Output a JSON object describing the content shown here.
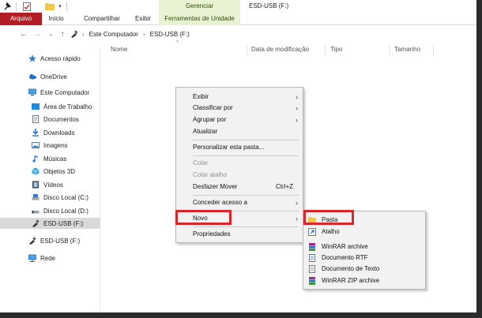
{
  "titlebar": {
    "window_title": "ESD-USB (F:)",
    "context_tab_group": "Gerenciar"
  },
  "ribbon_tabs": [
    {
      "label": "Arquivo"
    },
    {
      "label": "Início"
    },
    {
      "label": "Compartilhar"
    },
    {
      "label": "Exibir"
    },
    {
      "label": "Ferramentas de Unidade"
    }
  ],
  "address": {
    "path": [
      "Este Computador",
      "ESD-USB (F:)"
    ]
  },
  "sidebar": {
    "items": [
      {
        "label": "Acesso rápido",
        "icon": "star-icon"
      },
      {
        "label": "OneDrive",
        "icon": "cloud-icon"
      },
      {
        "label": "Este Computador",
        "icon": "computer-icon"
      },
      {
        "label": "Área de Trabalho",
        "icon": "desktop-icon"
      },
      {
        "label": "Documentos",
        "icon": "documents-icon"
      },
      {
        "label": "Downloads",
        "icon": "download-icon"
      },
      {
        "label": "Imagens",
        "icon": "pictures-icon"
      },
      {
        "label": "Músicas",
        "icon": "music-icon"
      },
      {
        "label": "Objetos 3D",
        "icon": "cube-icon"
      },
      {
        "label": "Vídeos",
        "icon": "video-icon"
      },
      {
        "label": "Disco Local (C:)",
        "icon": "drive-icon"
      },
      {
        "label": "Disco Local (D:)",
        "icon": "drive-icon"
      },
      {
        "label": "ESD-USB (F:)",
        "icon": "usb-icon"
      },
      {
        "label": "ESD-USB (F:)",
        "icon": "usb-icon"
      },
      {
        "label": "Rede",
        "icon": "network-icon"
      }
    ]
  },
  "columns": [
    "Nome",
    "Data de modificação",
    "Tipo",
    "Tamanho"
  ],
  "context_menu": {
    "items": [
      {
        "label": "Exibir",
        "submenu": true
      },
      {
        "label": "Classificar por",
        "submenu": true
      },
      {
        "label": "Agrupar por",
        "submenu": true
      },
      {
        "label": "Atualizar"
      },
      {
        "label": "Personalizar esta pasta..."
      },
      {
        "label": "Colar",
        "disabled": true
      },
      {
        "label": "Colar atalho",
        "disabled": true
      },
      {
        "label": "Desfazer Mover",
        "shortcut": "Ctrl+Z"
      },
      {
        "label": "Conceder acesso a",
        "submenu": true
      },
      {
        "label": "Novo",
        "submenu": true
      },
      {
        "label": "Propriedades"
      }
    ]
  },
  "submenu_novo": {
    "items": [
      {
        "label": "Pasta",
        "icon": "folder-icon"
      },
      {
        "label": "Atalho",
        "icon": "shortcut-icon"
      },
      {
        "label": "WinRAR archive",
        "icon": "winrar-icon"
      },
      {
        "label": "Documento RTF",
        "icon": "rtf-document-icon"
      },
      {
        "label": "Documento de Texto",
        "icon": "text-document-icon"
      },
      {
        "label": "WinRAR ZIP archive",
        "icon": "winrar-zip-icon"
      }
    ]
  },
  "colors": {
    "arquivo_tab": "#b31e25",
    "context_tab": "#e9f2d3",
    "highlight": "#d7262d",
    "folder": "#f3c74a"
  }
}
